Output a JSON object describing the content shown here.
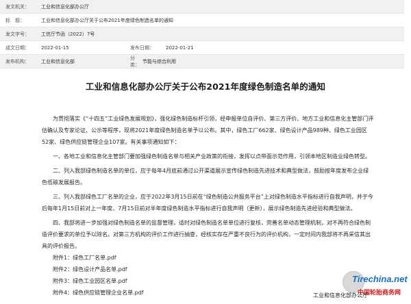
{
  "meta": {
    "issuer_label": "发文机关：",
    "issuer_value": "工业和信息化部办公厅",
    "title_label": "标　题：",
    "title_value": "工业和信息化部办公厅关于公布2021年度绿色制造名单的通知",
    "docno_label": "发文字号：",
    "docno_value": "工信厅节函（2022）7号",
    "created_label": "成文日期：",
    "created_value": "2022-01-15",
    "published_label": "发布日期：",
    "published_value": "2022-01-21",
    "org_label": "发布机构：",
    "org_value": "工业和信息化部",
    "cat_label": "分　类：",
    "cat_value": "节能与综合利用"
  },
  "doc": {
    "title": "工业和信息化部办公厅关于公布2021年度绿色制造名单的通知",
    "paragraphs": [
      "为贯彻落实《“十四五”工业绿色发展规划》，强化绿色制造标杆引领，经申报单位自评价、第三方评价、地方工业和信息化主管部门评估确认及专家论证、公示等程序，现将2021年度绿色制造名单予以公布。其中，绿色工厂662家、绿色设计产品989种、绿色工业园区52家、绿色供应链管理企业107家。有关事项通知如下：",
      "一、各地工业和信息化主管部门要加强绿色制造名单与相关产业政策的衔接，发挥以点带面示范作用，引领本地区制造业绿色转型。",
      "二、列入我部绿色制造名单的单位，应于每年4月底前通过公开渠道展示宣传绿色制造先进技术和典型做法，鼓励按年度发布企业绿色低碳发展报告。",
      "三、列入我部绿色工厂名单的企业，应于2022年3月15日前在“绿色制造公共服务平台”上对绿色制造水平指标进行自我声明，并于今后每年1月15日前对上一年度、7月15日前对半年度绿色制造水平指标进行自我声明（更新），展示绿色制造先进经验和典型做法。",
      "四、我部将进一步加强对绿色制造名单的监督管理，适时对绿色制造名单单位进行复核，完善名单动态管理机制，对不再符合绿色制造评价要求的单位予以除名。对第三方机构的评价工作进行抽查，经核实存在严重不良行为的评价机构，一定时间内我部将不再采信其出具的评价报告。"
    ],
    "attachments": [
      "附件1：绿色工厂名单.pdf",
      "附件2：绿色设计产品名单.pdf",
      "附件3：绿色工业园区名单.pdf",
      "附件4：绿色供应链管理企业名单.pdf"
    ],
    "signature": "工业和信息化部办公厅"
  },
  "watermark": {
    "site": "Tirechina.net",
    "site_cn": "中国轮胎商务网"
  }
}
